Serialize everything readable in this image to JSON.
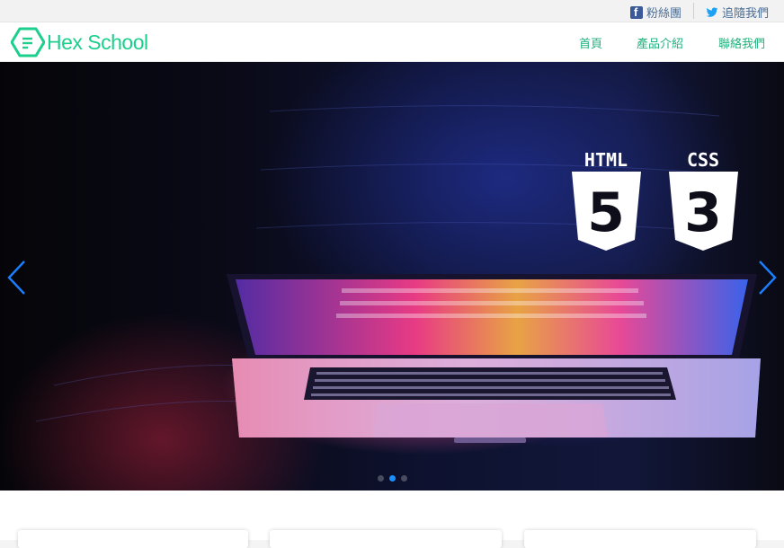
{
  "topbar": {
    "facebook_label": "粉絲團",
    "twitter_label": "追隨我們"
  },
  "nav": {
    "logo_text": "Hex School",
    "links": [
      "首頁",
      "產品介紹",
      "聯絡我們"
    ]
  },
  "hero": {
    "badges": [
      {
        "label": "HTML",
        "number": "5"
      },
      {
        "label": "CSS",
        "number": "3"
      }
    ],
    "slide_count": 3,
    "active_slide": 2
  },
  "colors": {
    "brand_green": "#1ccf8c",
    "nav_link": "#23b07e",
    "carousel_arrow": "#1a7fff",
    "facebook": "#3b5998",
    "twitter": "#1da1f2"
  }
}
